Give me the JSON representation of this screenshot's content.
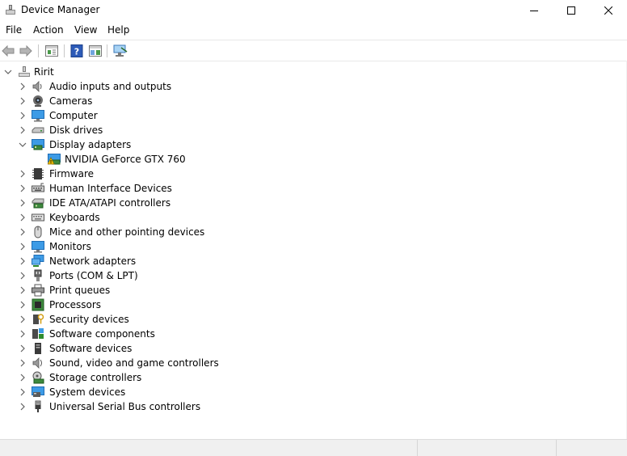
{
  "window": {
    "title": "Device Manager",
    "controls": [
      "minimize-icon",
      "maximize-icon",
      "close-icon"
    ]
  },
  "menu": [
    "File",
    "Action",
    "View",
    "Help"
  ],
  "toolbar": {
    "buttons": [
      "back-arrow-icon",
      "forward-arrow-icon",
      "properties-pane-icon",
      "help-icon",
      "show-hide-icon",
      "scan-hardware-icon"
    ]
  },
  "tree": {
    "root": "Ririt",
    "categories": [
      {
        "label": "Audio inputs and outputs",
        "icon": "speaker-icon",
        "expanded": false
      },
      {
        "label": "Cameras",
        "icon": "camera-icon",
        "expanded": false
      },
      {
        "label": "Computer",
        "icon": "computer-icon",
        "expanded": false
      },
      {
        "label": "Disk drives",
        "icon": "disk-drive-icon",
        "expanded": false
      },
      {
        "label": "Display adapters",
        "icon": "display-adapter-icon",
        "expanded": true,
        "children": [
          {
            "label": "NVIDIA GeForce GTX 760",
            "icon": "warning-display-adapter-icon"
          }
        ]
      },
      {
        "label": "Firmware",
        "icon": "firmware-icon",
        "expanded": false
      },
      {
        "label": "Human Interface Devices",
        "icon": "hid-icon",
        "expanded": false
      },
      {
        "label": "IDE ATA/ATAPI controllers",
        "icon": "ide-controller-icon",
        "expanded": false
      },
      {
        "label": "Keyboards",
        "icon": "keyboard-icon",
        "expanded": false
      },
      {
        "label": "Mice and other pointing devices",
        "icon": "mouse-icon",
        "expanded": false
      },
      {
        "label": "Monitors",
        "icon": "monitor-icon",
        "expanded": false
      },
      {
        "label": "Network adapters",
        "icon": "network-adapter-icon",
        "expanded": false
      },
      {
        "label": "Ports (COM & LPT)",
        "icon": "port-icon",
        "expanded": false
      },
      {
        "label": "Print queues",
        "icon": "printer-icon",
        "expanded": false
      },
      {
        "label": "Processors",
        "icon": "processor-icon",
        "expanded": false
      },
      {
        "label": "Security devices",
        "icon": "security-device-icon",
        "expanded": false
      },
      {
        "label": "Software components",
        "icon": "software-component-icon",
        "expanded": false
      },
      {
        "label": "Software devices",
        "icon": "software-device-icon",
        "expanded": false
      },
      {
        "label": "Sound, video and game controllers",
        "icon": "sound-controller-icon",
        "expanded": false
      },
      {
        "label": "Storage controllers",
        "icon": "storage-controller-icon",
        "expanded": false
      },
      {
        "label": "System devices",
        "icon": "system-device-icon",
        "expanded": false
      },
      {
        "label": "Universal Serial Bus controllers",
        "icon": "usb-icon",
        "expanded": false
      }
    ]
  },
  "colors": {
    "accent_blue": "#1e7fd6",
    "warning_yellow": "#f5c400",
    "chevron": "#606060"
  }
}
